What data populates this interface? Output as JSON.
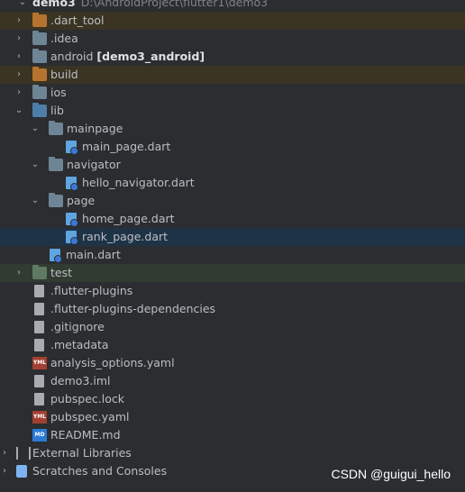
{
  "root": {
    "name": "demo3",
    "path": "D:\\AndroidProject\\flutter1\\demo3"
  },
  "items": [
    {
      "label": ".dart_tool"
    },
    {
      "label": ".idea"
    },
    {
      "label": "android",
      "extra": "[demo3_android]"
    },
    {
      "label": "build"
    },
    {
      "label": "ios"
    },
    {
      "label": "lib"
    },
    {
      "label": "mainpage"
    },
    {
      "label": "main_page.dart"
    },
    {
      "label": "navigator"
    },
    {
      "label": "hello_navigator.dart"
    },
    {
      "label": "page"
    },
    {
      "label": "home_page.dart"
    },
    {
      "label": "rank_page.dart"
    },
    {
      "label": "main.dart"
    },
    {
      "label": "test"
    },
    {
      "label": ".flutter-plugins"
    },
    {
      "label": ".flutter-plugins-dependencies"
    },
    {
      "label": ".gitignore"
    },
    {
      "label": ".metadata"
    },
    {
      "label": "analysis_options.yaml"
    },
    {
      "label": "demo3.iml"
    },
    {
      "label": "pubspec.lock"
    },
    {
      "label": "pubspec.yaml"
    },
    {
      "label": "README.md"
    },
    {
      "label": "External Libraries"
    },
    {
      "label": "Scratches and Consoles"
    }
  ],
  "icons": {
    "yaml_badge": "YML",
    "md_badge": "MD"
  },
  "watermark": "CSDN @guigui_hello"
}
